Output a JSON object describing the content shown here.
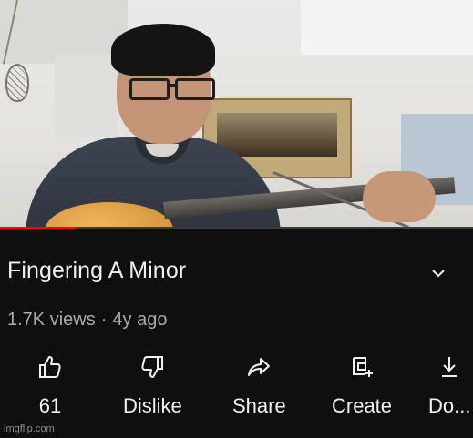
{
  "video": {
    "progress_fraction": 0.16
  },
  "info": {
    "title": "Fingering A Minor",
    "views": "1.7K views",
    "separator": "·",
    "age": "4y ago"
  },
  "actions": [
    {
      "icon": "thumbs-up-icon",
      "label": "61"
    },
    {
      "icon": "thumbs-down-icon",
      "label": "Dislike"
    },
    {
      "icon": "share-arrow-icon",
      "label": "Share"
    },
    {
      "icon": "create-sparkle-icon",
      "label": "Create"
    },
    {
      "icon": "download-icon",
      "label": "Do..."
    }
  ],
  "watermark": "imgflip.com",
  "colors": {
    "background": "#0f0f0f",
    "progress": "#ff0000",
    "text_primary": "#f1f1f1",
    "text_secondary": "#aaaaaa"
  }
}
